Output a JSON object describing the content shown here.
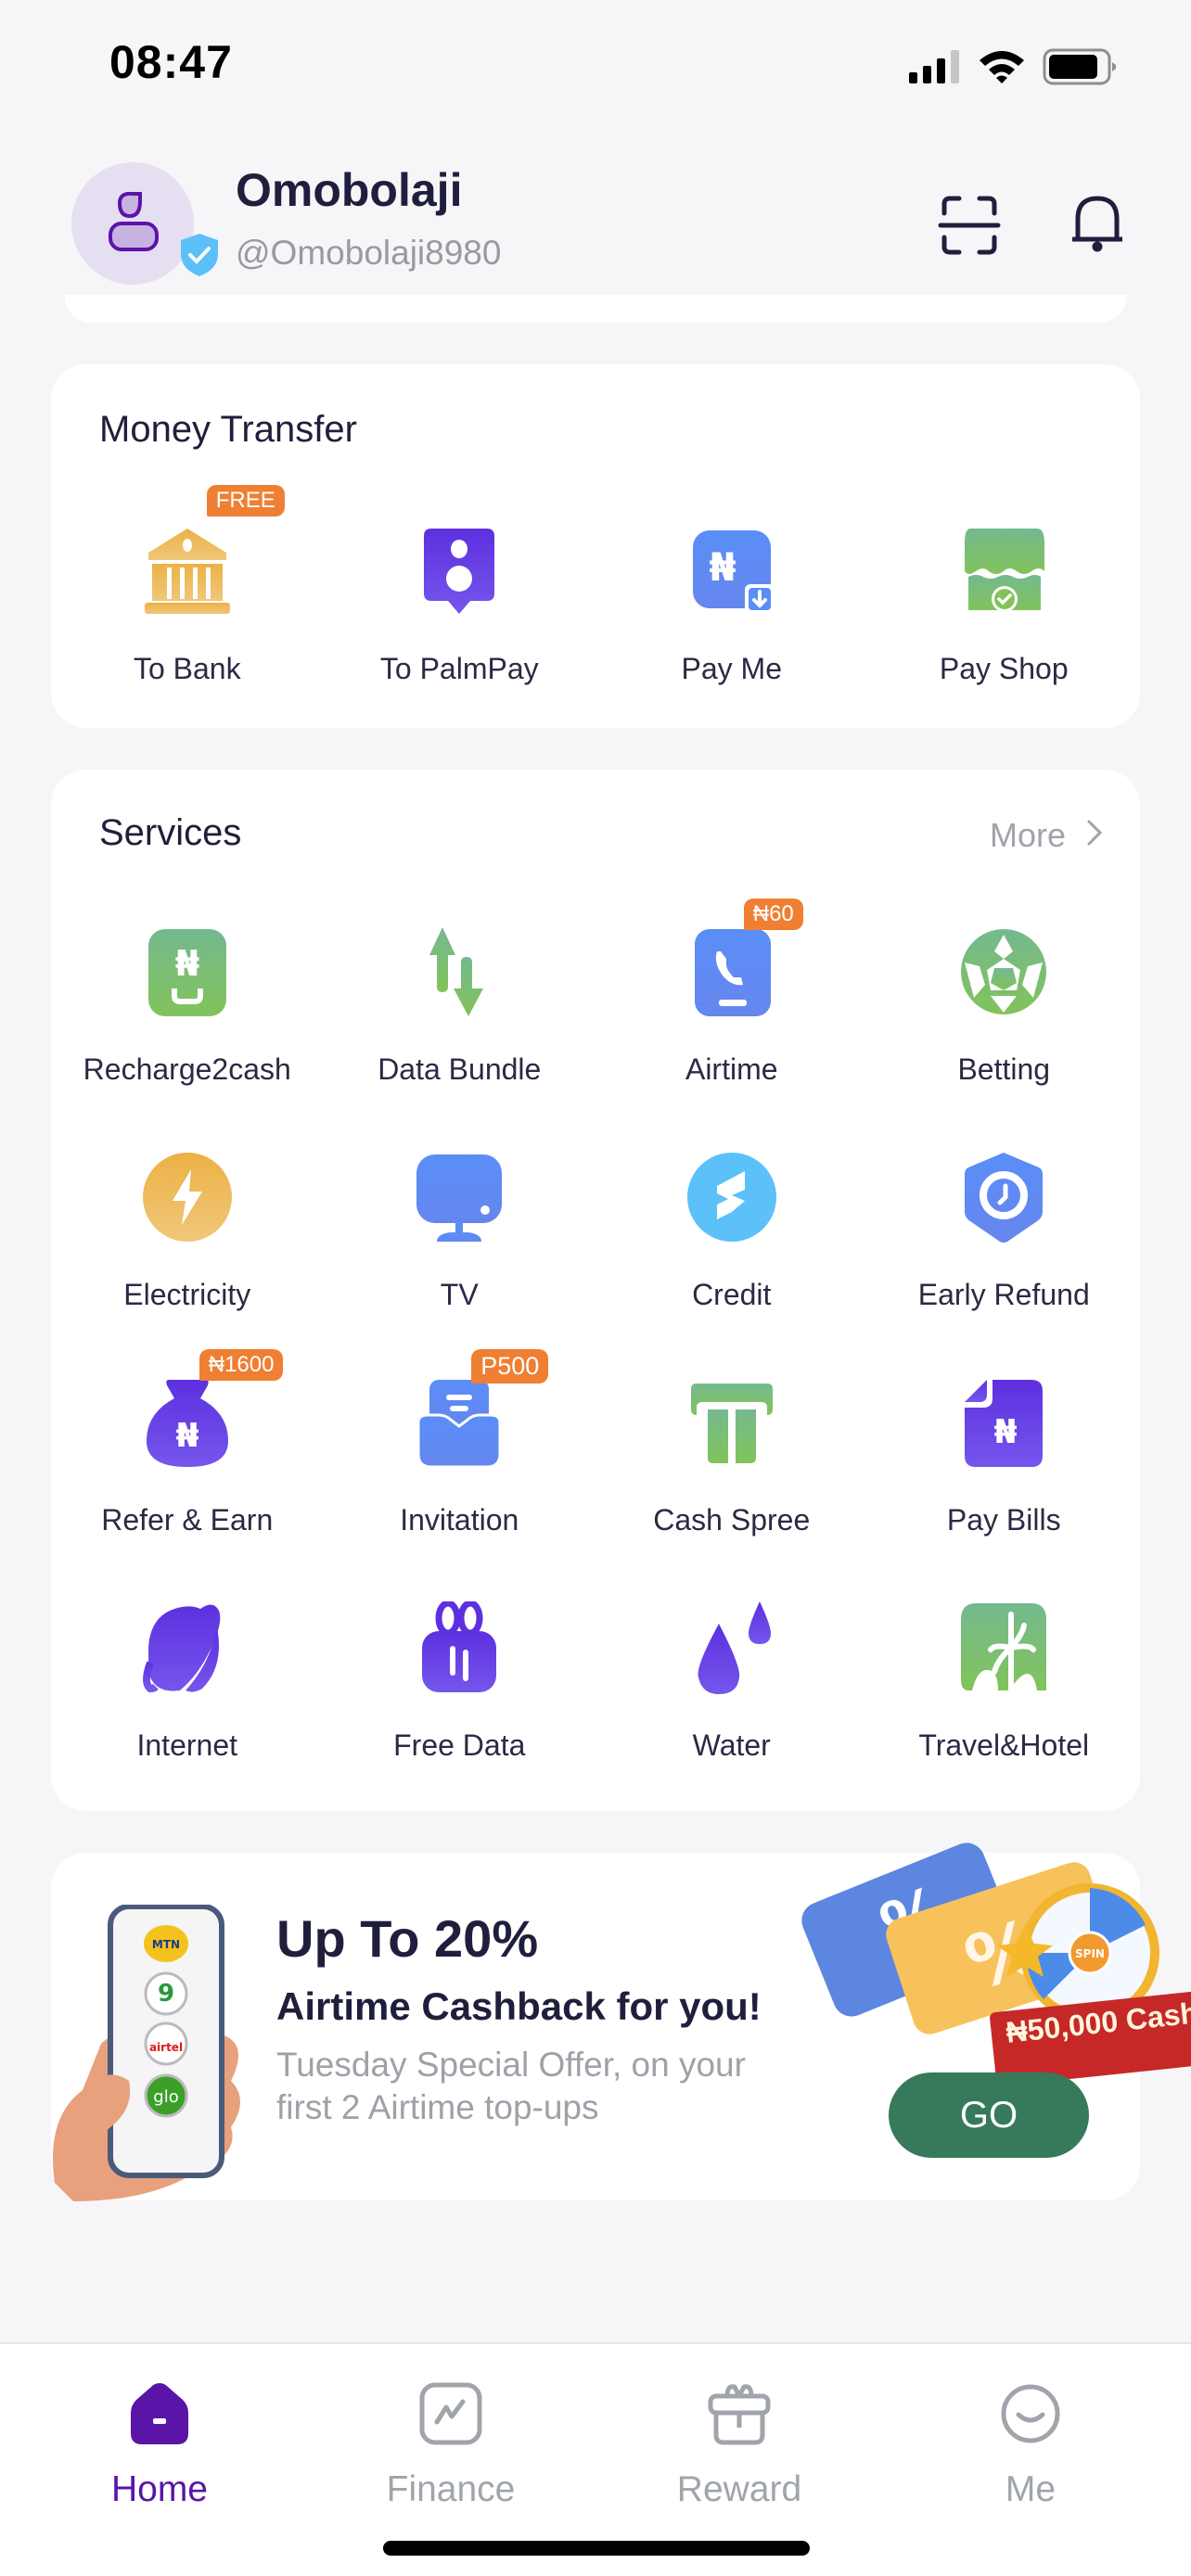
{
  "status_bar": {
    "time": "08:47",
    "signal_icon": "cellular-signal-icon",
    "wifi_icon": "wifi-icon",
    "battery_icon": "battery-icon"
  },
  "header": {
    "name": "Omobolaji",
    "handle": "@Omobolaji8980",
    "avatar_icon": "user-icon",
    "verified_icon": "verified-shield-icon",
    "scan_icon": "scan-icon",
    "notification_icon": "bell-icon"
  },
  "money_transfer": {
    "title": "Money Transfer",
    "items": [
      {
        "label": "To Bank",
        "icon": "bank-icon",
        "badge": "FREE"
      },
      {
        "label": "To PalmPay",
        "icon": "palmpay-icon",
        "badge": null
      },
      {
        "label": "Pay Me",
        "icon": "pay-me-icon",
        "badge": null
      },
      {
        "label": "Pay Shop",
        "icon": "shop-icon",
        "badge": null
      }
    ]
  },
  "services": {
    "title": "Services",
    "more_label": "More",
    "items": [
      {
        "label": "Recharge2cash",
        "icon": "recharge2cash-icon",
        "badge": null
      },
      {
        "label": "Data Bundle",
        "icon": "data-arrows-icon",
        "badge": null
      },
      {
        "label": "Airtime",
        "icon": "phone-icon",
        "badge": "₦60"
      },
      {
        "label": "Betting",
        "icon": "soccer-ball-icon",
        "badge": null
      },
      {
        "label": "Electricity",
        "icon": "lightning-icon",
        "badge": null
      },
      {
        "label": "TV",
        "icon": "tv-icon",
        "badge": null
      },
      {
        "label": "Credit",
        "icon": "credit-icon",
        "badge": null
      },
      {
        "label": "Early Refund",
        "icon": "clock-shield-icon",
        "badge": null
      },
      {
        "label": "Refer & Earn",
        "icon": "money-bag-icon",
        "badge": "₦1600"
      },
      {
        "label": "Invitation",
        "icon": "invitation-icon",
        "badge": "P500"
      },
      {
        "label": "Cash Spree",
        "icon": "atm-icon",
        "badge": null
      },
      {
        "label": "Pay Bills",
        "icon": "bill-icon",
        "badge": null
      },
      {
        "label": "Internet",
        "icon": "planet-icon",
        "badge": null
      },
      {
        "label": "Free Data",
        "icon": "gift-data-icon",
        "badge": null
      },
      {
        "label": "Water",
        "icon": "water-drop-icon",
        "badge": null
      },
      {
        "label": "Travel&Hotel",
        "icon": "palm-tree-icon",
        "badge": null
      }
    ]
  },
  "promo": {
    "title": "Up To 20%",
    "subtitle": "Airtime Cashback for you!",
    "description": "Tuesday Special Offer, on your first 2 Airtime top-ups",
    "button_label": "GO",
    "prize_text": "₦50,000 Cash",
    "carriers": [
      "MTN",
      "9mobile",
      "airtel",
      "glo"
    ]
  },
  "bottom_nav": {
    "items": [
      {
        "label": "Home",
        "icon": "home-icon",
        "active": true
      },
      {
        "label": "Finance",
        "icon": "finance-chart-icon",
        "active": false
      },
      {
        "label": "Reward",
        "icon": "gift-icon",
        "active": false
      },
      {
        "label": "Me",
        "icon": "smile-icon",
        "active": false
      }
    ]
  },
  "colors": {
    "brand_purple": "#5a14a8",
    "badge_orange": "#ef7f33",
    "go_green": "#367a5b",
    "text_dark": "#1f1f3d",
    "text_muted": "#a0a4ab"
  }
}
